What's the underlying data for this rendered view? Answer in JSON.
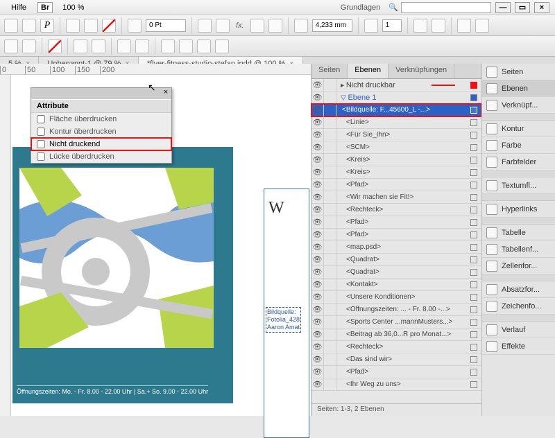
{
  "topbar": {
    "help": "Hilfe",
    "br": "Br",
    "zoom": "100 %",
    "basis": "Grundlagen"
  },
  "ribbon2": {
    "stroke": "0 Pt",
    "meas": "4,233 mm",
    "idx": "1"
  },
  "doctabs": [
    {
      "label": "5 %",
      "close": "×"
    },
    {
      "label": "Unbenannt-1 @ 79 %",
      "close": "×"
    },
    {
      "label": "*flyer-fitness-studio-stefan.indd @ 100 %",
      "close": "×"
    }
  ],
  "ruler": [
    "0",
    "50",
    "100",
    "150",
    "200"
  ],
  "attr": {
    "title": "Attribute",
    "items": [
      {
        "label": "Fläche überdrucken"
      },
      {
        "label": "Kontur überdrucken"
      },
      {
        "label": "Nicht druckend",
        "hl": true
      },
      {
        "label": "Lücke überdrucken"
      }
    ]
  },
  "page": {
    "opening": "Öffnungszeiten: Mo. - Fr. 8.00 - 22.00 Uhr | Sa.+ So. 9.00 - 22.00 Uhr"
  },
  "page2": {
    "W": "W",
    "cred": "Bildquelle:\nFotolia_428\nAaron Amat"
  },
  "layerTabs": [
    "Seiten",
    "Ebenen",
    "Verknüpfungen"
  ],
  "layers": {
    "top": "Nicht druckbar",
    "group": "Ebene 1",
    "sel": "<Bildquelle: F...45600_L -...>",
    "items": [
      "<Linie>",
      "<Für Sie_Ihn>",
      "<SCM>",
      "<Kreis>",
      "<Kreis>",
      "<Pfad>",
      "<Wir machen sie Fit!>",
      "<Rechteck>",
      "<Pfad>",
      "<Pfad>",
      "<map.psd>",
      "<Quadrat>",
      "<Quadrat>",
      "<Kontakt>",
      "<Unsere Konditionen>",
      "<Öffnungszeiten: ... - Fr. 8.00 -...>",
      "<Sports Center ...mannMusters...>",
      "<Beitrag ab 36,0...R pro Monat...>",
      "<Rechteck>",
      "<Das sind wir>",
      "<Pfad>",
      "<Ihr Weg zu uns>"
    ],
    "foot": "Seiten: 1-3, 2 Ebenen"
  },
  "sidebar": [
    "Seiten",
    "Ebenen",
    "Verknüpf...",
    "",
    "Kontur",
    "Farbe",
    "Farbfelder",
    "",
    "Textumfl...",
    "",
    "Hyperlinks",
    "",
    "Tabelle",
    "Tabellenf...",
    "Zellenfor...",
    "",
    "Absatzfor...",
    "Zeichenfo...",
    "",
    "Verlauf",
    "Effekte"
  ]
}
